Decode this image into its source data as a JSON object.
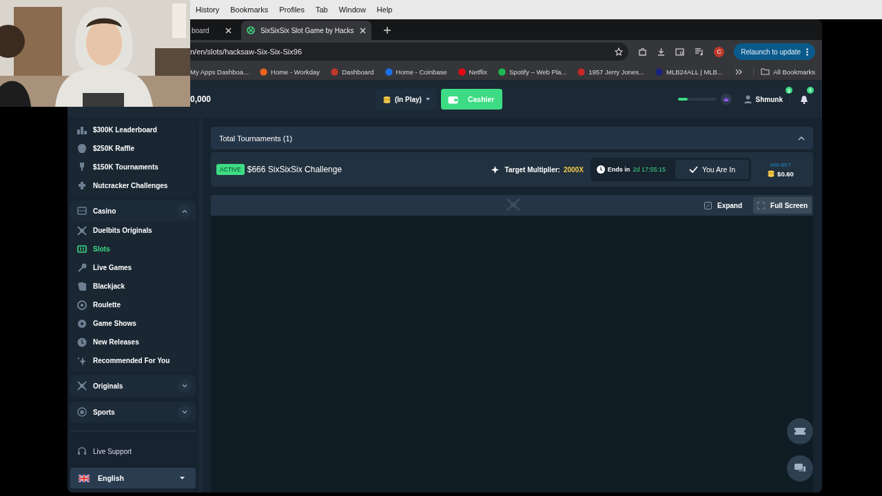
{
  "menu_bar": {
    "items": [
      "History",
      "Bookmarks",
      "Profiles",
      "Tab",
      "Window",
      "Help"
    ]
  },
  "browser": {
    "tabs": [
      {
        "title": "board",
        "selected": false
      },
      {
        "title": "SixSixSix Slot Game by Hacks",
        "selected": true
      }
    ],
    "address": "n/en/slots/hacksaw-Six-Six-Six96",
    "profile_initial": "C",
    "relaunch_button": "Relaunch to update",
    "bookmarks": [
      "My Apps Dashboa...",
      "Home - Workday",
      "Dashboard",
      "Home - Coinbase",
      "Netflix",
      "Spotify – Web Pla...",
      "1957 Jerry Jones...",
      "MLB24ALL | MLB..."
    ],
    "all_bookmarks": "All Bookmarks"
  },
  "header": {
    "balance": "0,000",
    "wallet": "(In Play)",
    "cashier_button": "Cashier",
    "level_bar": {
      "level": 0.25
    },
    "username": "Shmunk",
    "user_badge": "1",
    "notification_badge": "4"
  },
  "sidebar": {
    "promos": [
      "$300K Leaderboard",
      "$250K Raffle",
      "$150K Tournaments",
      "Nutcracker Challenges"
    ],
    "sections": [
      {
        "label": "Casino",
        "expanded": true,
        "items": [
          {
            "label": "Duelbits Originals",
            "selected": false
          },
          {
            "label": "Slots",
            "selected": true
          },
          {
            "label": "Live Games",
            "selected": false
          },
          {
            "label": "Blackjack",
            "selected": false
          },
          {
            "label": "Roulette",
            "selected": false
          },
          {
            "label": "Game Shows",
            "selected": false
          },
          {
            "label": "New Releases",
            "selected": false
          },
          {
            "label": "Recommended For You",
            "selected": false
          }
        ]
      },
      {
        "label": "Originals",
        "expanded": false
      },
      {
        "label": "Sports",
        "expanded": false
      }
    ],
    "live_support": "Live Support",
    "language": "English"
  },
  "tournaments": {
    "title": "Total Tournaments (1)",
    "expanded": true,
    "items": [
      {
        "status": "ACTIVE",
        "name": "$666 SixSixSix Challenge",
        "target_label": "Target Multiplier:",
        "target_value": "2000X",
        "ends_label": "Ends in",
        "ends_value": "2d 17:55:15",
        "joined": "You Are In",
        "min_bet_label": "MIN BET",
        "min_bet": "$0.60"
      }
    ]
  },
  "game_toolbar": {
    "expand_button": "Expand",
    "fullscreen_button": "Full Screen"
  }
}
